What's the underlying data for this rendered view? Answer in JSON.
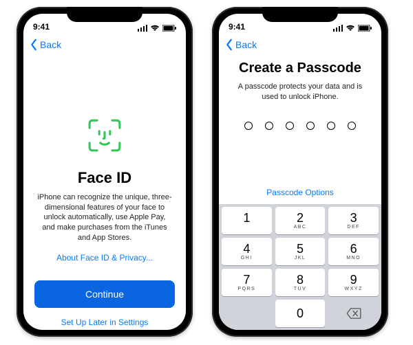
{
  "status": {
    "time": "9:41"
  },
  "nav": {
    "back": "Back"
  },
  "faceid": {
    "title": "Face ID",
    "description": "iPhone can recognize the unique, three-dimensional features of your face to unlock automatically, use Apple Pay, and make purchases from the iTunes and App Stores.",
    "about_link": "About Face ID & Privacy...",
    "continue": "Continue",
    "skip": "Set Up Later in Settings"
  },
  "passcode": {
    "title": "Create a Passcode",
    "description": "A passcode protects your data and is used to unlock iPhone.",
    "options": "Passcode Options",
    "digits": 6,
    "keys": [
      {
        "n": "1",
        "s": ""
      },
      {
        "n": "2",
        "s": "ABC"
      },
      {
        "n": "3",
        "s": "DEF"
      },
      {
        "n": "4",
        "s": "GHI"
      },
      {
        "n": "5",
        "s": "JKL"
      },
      {
        "n": "6",
        "s": "MNO"
      },
      {
        "n": "7",
        "s": "PQRS"
      },
      {
        "n": "8",
        "s": "TUV"
      },
      {
        "n": "9",
        "s": "WXYZ"
      },
      {
        "n": "0",
        "s": ""
      }
    ]
  }
}
